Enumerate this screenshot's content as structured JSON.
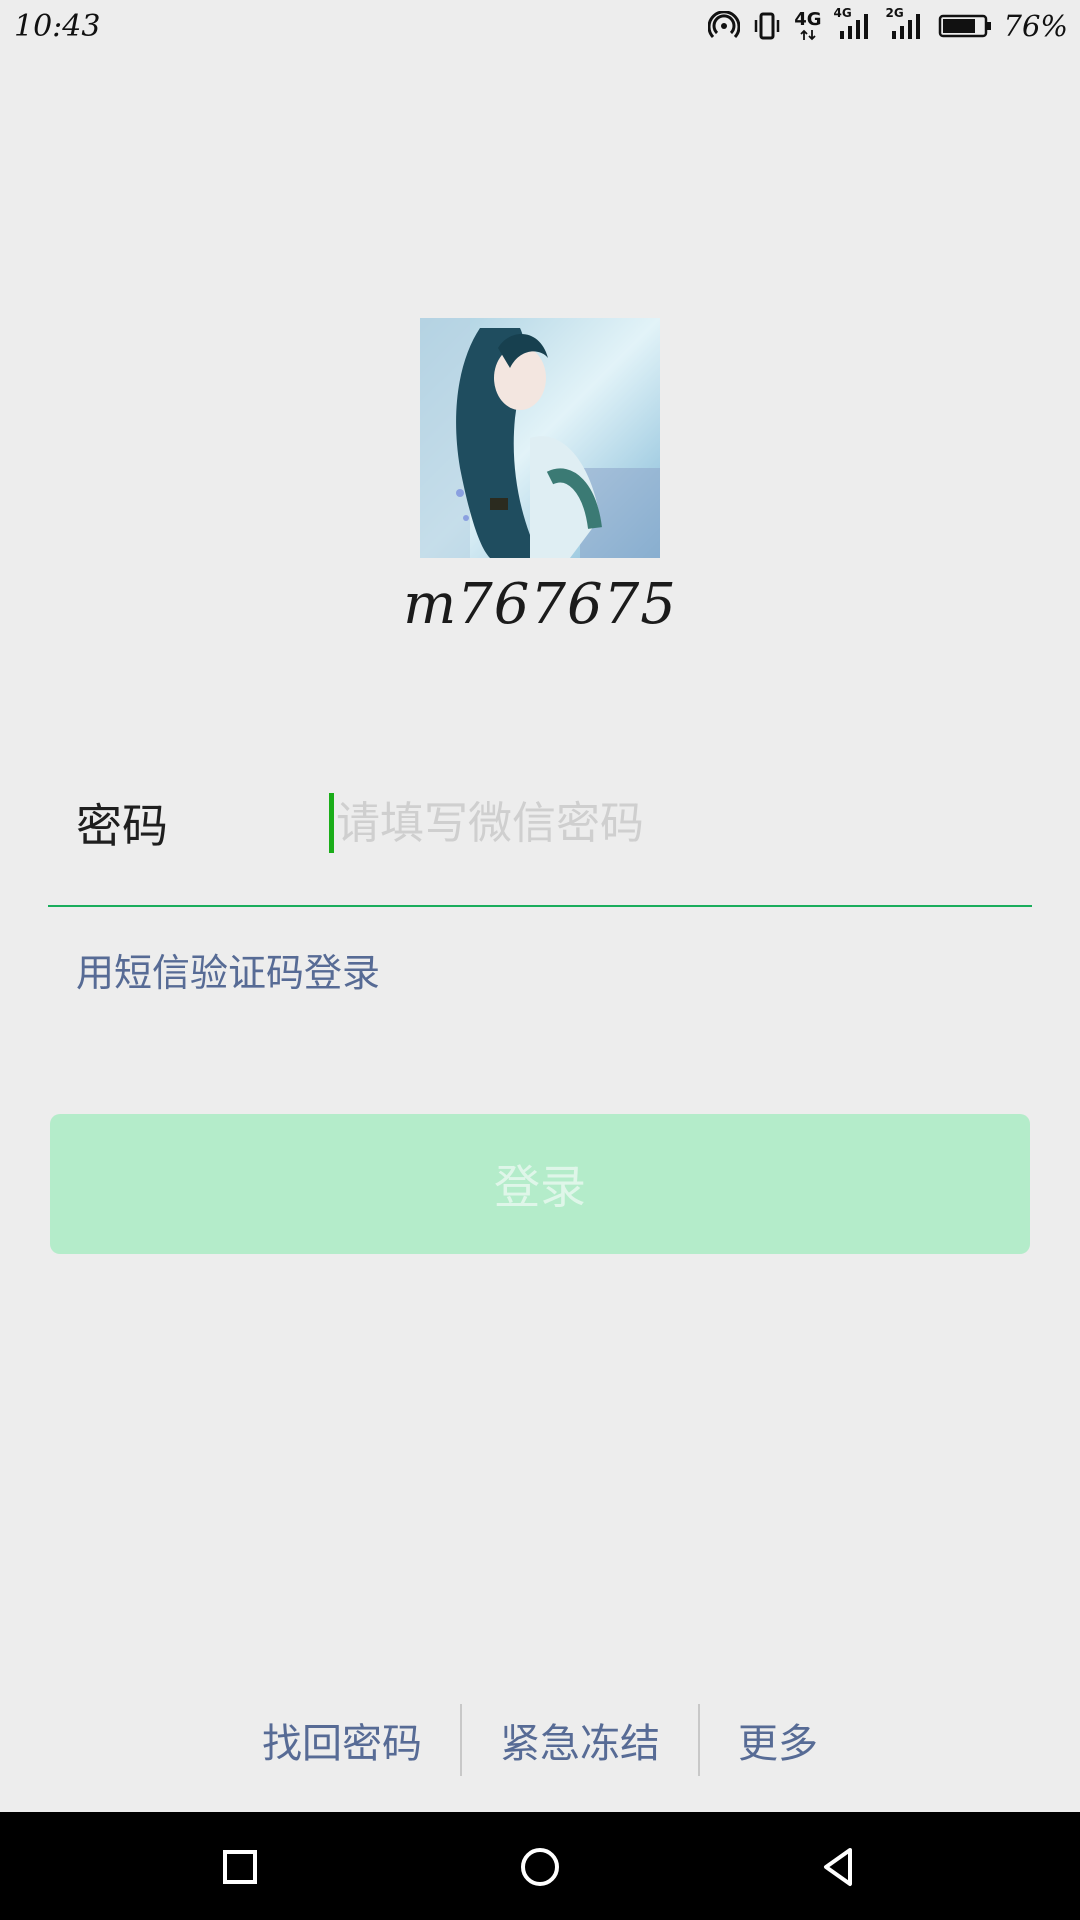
{
  "status_bar": {
    "time": "10:43",
    "network_1": "4G",
    "network_2": "4G",
    "network_3": "2G",
    "battery_percent": "76%",
    "battery_level": 0.76
  },
  "profile": {
    "username": "m767675"
  },
  "password_field": {
    "label": "密码",
    "placeholder": "请填写微信密码",
    "value": ""
  },
  "sms_login_label": "用短信验证码登录",
  "login_button_label": "登录",
  "footer": {
    "recover_password": "找回密码",
    "emergency_freeze": "紧急冻结",
    "more": "更多"
  },
  "colors": {
    "accent": "#1aad19",
    "link": "#576b95",
    "login_disabled_bg": "#b4ecca"
  }
}
